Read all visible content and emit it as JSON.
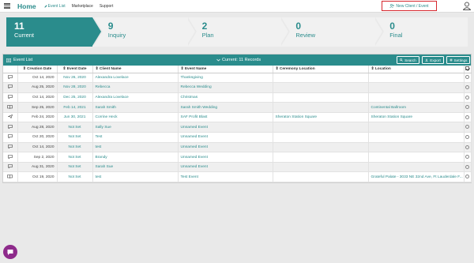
{
  "nav": {
    "home": "Home",
    "tabs": [
      "Event List",
      "Marketplace",
      "Support"
    ],
    "new_button": "New Client / Event"
  },
  "stages": [
    {
      "count": "11",
      "label": "Current"
    },
    {
      "count": "9",
      "label": "Inquiry"
    },
    {
      "count": "2",
      "label": "Plan"
    },
    {
      "count": "0",
      "label": "Review"
    },
    {
      "count": "0",
      "label": "Final"
    }
  ],
  "panel": {
    "title": "Event List",
    "records": "Current: 11 Records",
    "search": "Search",
    "export": "Export",
    "settings": "Settings"
  },
  "table": {
    "headers": [
      "Creation Date",
      "Event Date",
      "Client Name",
      "Event Name",
      "Ceremony Location",
      "Location"
    ],
    "rows": [
      {
        "icon": "chat-icon",
        "creation": "Oct 14, 2020",
        "event_date": "Nov 26, 2020",
        "client": "Alexandra Lovelace",
        "event": "Thanksgiving",
        "ceremony": "",
        "location": ""
      },
      {
        "icon": "chat-icon",
        "creation": "Aug 25, 2020",
        "event_date": "Nov 28, 2020",
        "client": "Rebecca",
        "event": "Rebecca Wedding",
        "ceremony": "",
        "location": ""
      },
      {
        "icon": "chat-icon",
        "creation": "Oct 14, 2020",
        "event_date": "Dec 25, 2020",
        "client": "Alexandra Lovelace",
        "event": "Christmas",
        "ceremony": "",
        "location": ""
      },
      {
        "icon": "book-icon",
        "creation": "Sep 25, 2020",
        "event_date": "Feb 14, 2021",
        "client": "Sarah Smith",
        "event": "Sarah Smith Wedding",
        "ceremony": "",
        "location": "Continental Ballroom"
      },
      {
        "icon": "send-icon",
        "creation": "Feb 24, 2020",
        "event_date": "Jun 30, 2021",
        "client": "Corrine Heck",
        "event": "SAF Profit Blast",
        "ceremony": "Sheraton Station Square",
        "location": "Sheraton Station Square"
      },
      {
        "icon": "chat-icon",
        "creation": "Aug 28, 2020",
        "event_date": "Not Set",
        "client": "Sally Sue",
        "event": "Unnamed Event",
        "ceremony": "",
        "location": ""
      },
      {
        "icon": "chat-icon",
        "creation": "Oct 20, 2020",
        "event_date": "Not Set",
        "client": "Test",
        "event": "Unnamed Event",
        "ceremony": "",
        "location": ""
      },
      {
        "icon": "chat-icon",
        "creation": "Oct 14, 2020",
        "event_date": "Not Set",
        "client": "test",
        "event": "Unnamed Event",
        "ceremony": "",
        "location": ""
      },
      {
        "icon": "chat-icon",
        "creation": "Sep 2, 2020",
        "event_date": "Not Set",
        "client": "Brandy",
        "event": "Unnamed Event",
        "ceremony": "",
        "location": ""
      },
      {
        "icon": "chat-icon",
        "creation": "Aug 31, 2020",
        "event_date": "Not Set",
        "client": "Sarah Sue",
        "event": "Unnamed Event",
        "ceremony": "",
        "location": ""
      },
      {
        "icon": "book-icon",
        "creation": "Oct 19, 2020",
        "event_date": "Not Set",
        "client": "test",
        "event": "Test Event",
        "ceremony": "",
        "location": "Grateful Palate - 3033 NE 32nd Ave, Ft Lauderdale F..."
      }
    ]
  },
  "colors": {
    "accent": "#2a8c8c",
    "highlight": "#d6262d",
    "chat": "#8e2b8b"
  }
}
